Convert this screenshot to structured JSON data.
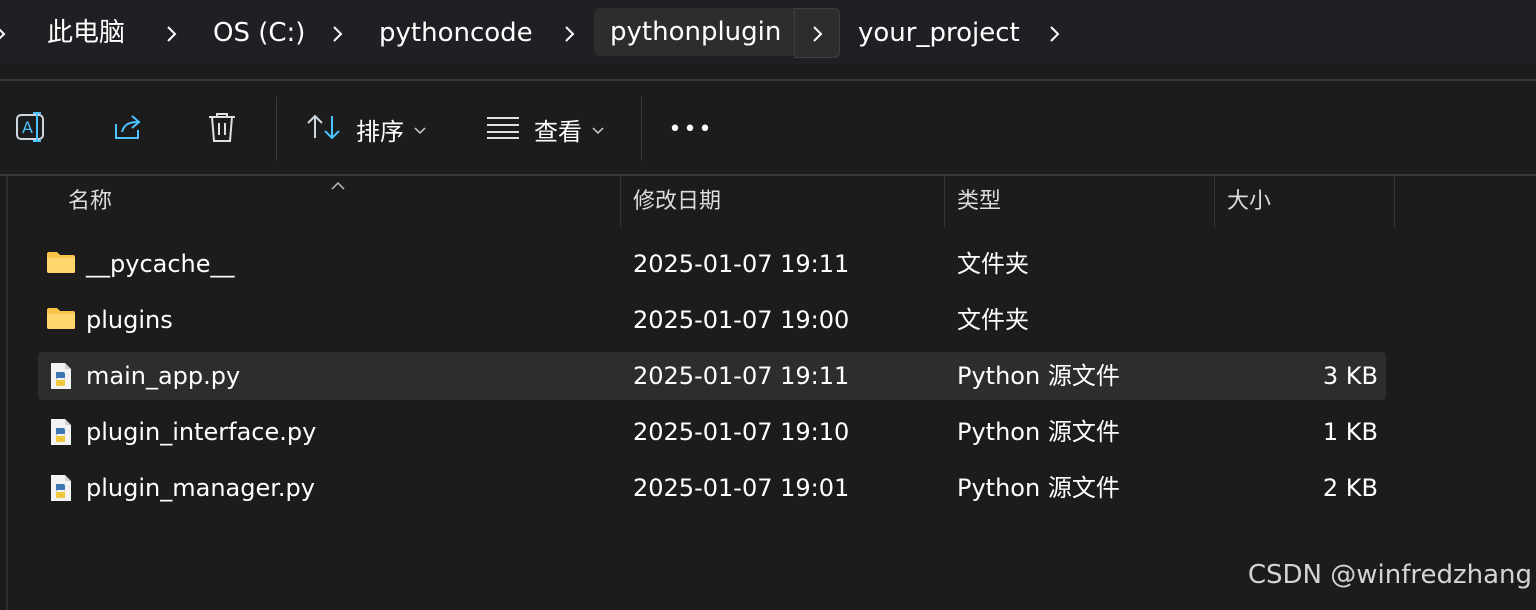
{
  "breadcrumb": {
    "items": [
      "此电脑",
      "OS (C:)",
      "pythoncode",
      "pythonplugin",
      "your_project"
    ]
  },
  "toolbar": {
    "rename_icon": "rename-icon",
    "share_icon": "share-icon",
    "delete_icon": "trash-icon",
    "sort_label": "排序",
    "view_label": "查看",
    "more_label": "•••"
  },
  "columns": {
    "name": "名称",
    "modified": "修改日期",
    "type": "类型",
    "size": "大小"
  },
  "files": [
    {
      "name": "__pycache__",
      "modified": "2025-01-07 19:11",
      "type": "文件夹",
      "size": "",
      "icon": "folder-icon"
    },
    {
      "name": "plugins",
      "modified": "2025-01-07 19:00",
      "type": "文件夹",
      "size": "",
      "icon": "folder-icon"
    },
    {
      "name": "main_app.py",
      "modified": "2025-01-07 19:11",
      "type": "Python 源文件",
      "size": "3 KB",
      "icon": "python-file-icon",
      "selected": true
    },
    {
      "name": "plugin_interface.py",
      "modified": "2025-01-07 19:10",
      "type": "Python 源文件",
      "size": "1 KB",
      "icon": "python-file-icon"
    },
    {
      "name": "plugin_manager.py",
      "modified": "2025-01-07 19:01",
      "type": "Python 源文件",
      "size": "2 KB",
      "icon": "python-file-icon"
    }
  ],
  "watermark": "CSDN @winfredzhang",
  "colors": {
    "background": "#1c1c1c",
    "breadcrumb_bar": "#1f2024",
    "selected_row": "#2d2d2d",
    "folder": "#f8c44a",
    "accent_icon": "#4cc2ff"
  }
}
